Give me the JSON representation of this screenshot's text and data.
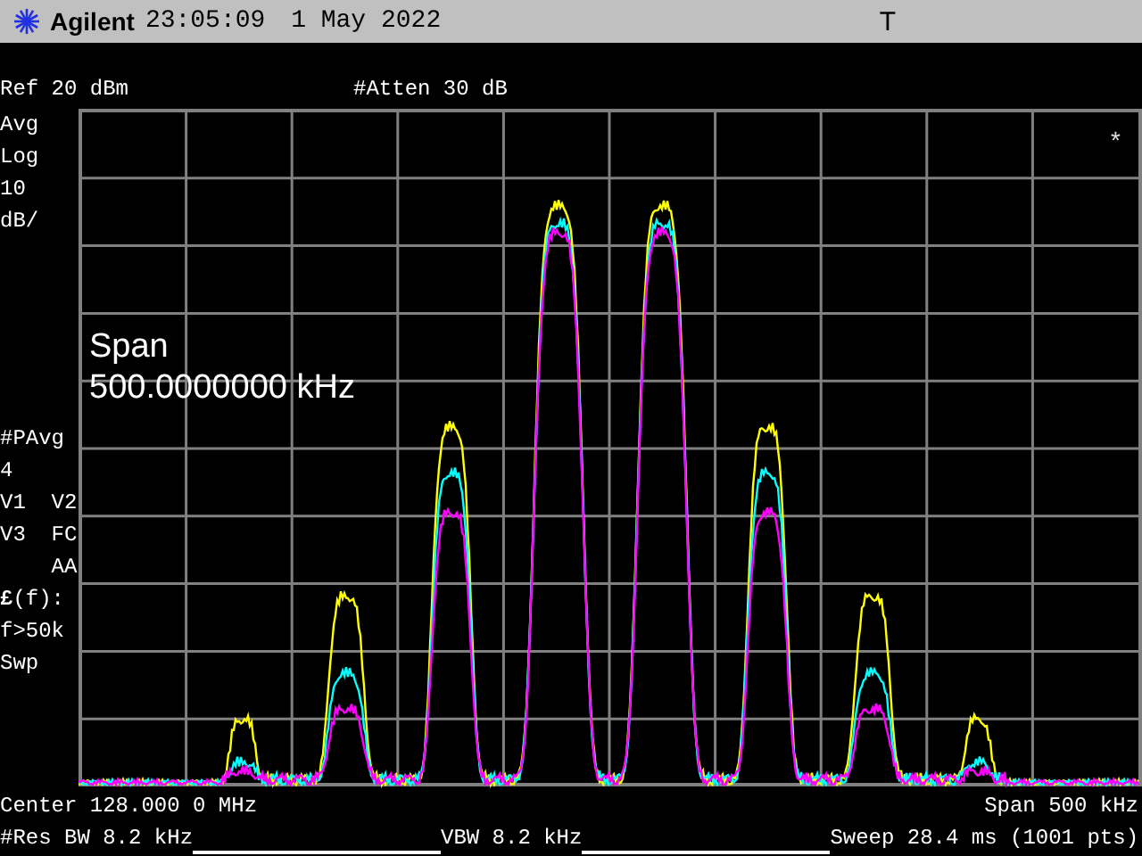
{
  "header": {
    "brand": "Agilent",
    "time": "23:05:09",
    "date": "1 May 2022",
    "trigger": "T"
  },
  "top": {
    "reference": "Ref 20 dBm",
    "attenuation": "#Atten 30 dB"
  },
  "scale_labels": [
    "Avg",
    "Log",
    "10",
    "dB/"
  ],
  "trace_labels": [
    "#PAvg",
    "4",
    "V1  V2",
    "V3  FC",
    "    AA",
    "**£**(f):",
    "f>50k",
    "Swp"
  ],
  "span_overlay": {
    "title": "Span",
    "value": "500.0000000 kHz"
  },
  "marker": "*",
  "bottom": {
    "center": "Center 128.000 0 MHz",
    "span": "Span 500 kHz",
    "res_bw": "#Res BW 8.2 kHz",
    "vbw": "VBW 8.2 kHz",
    "sweep": "Sweep 28.4 ms (1001 pts)"
  }
}
